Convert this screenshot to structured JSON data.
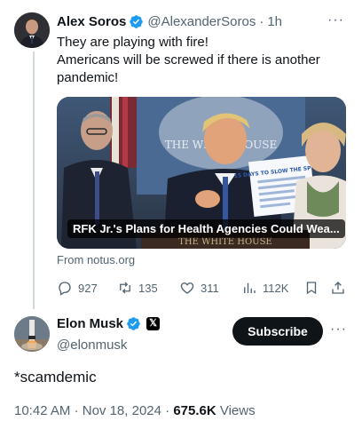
{
  "tweet1": {
    "author_name": "Alex Soros",
    "handle": "@AlexanderSoros",
    "separator": "·",
    "time": "1h",
    "text_lines": [
      "They are playing with fire!",
      "Americans will be screwed if there is another",
      "pandemic!"
    ],
    "card": {
      "caption": "RFK Jr.'s Plans for Health Agencies Could Wea...",
      "source": "From notus.org",
      "sign_text": "THE WHITE HOUSE",
      "sign_text_lower": "THE WHITE HOUSE",
      "paper_text": "15 DAYS TO SLOW THE SPREAD"
    },
    "actions": {
      "replies": "927",
      "reposts": "135",
      "likes": "311",
      "views": "112K"
    }
  },
  "tweet2": {
    "author_name": "Elon Musk",
    "handle": "@elonmusk",
    "affiliate_badge": "𝕏",
    "subscribe_label": "Subscribe",
    "text": "*scamdemic",
    "time": "10:42 AM",
    "separator": "·",
    "date": "Nov 18, 2024",
    "separator2": "·",
    "views_count": "675.6K",
    "views_label": "Views"
  },
  "colors": {
    "verified": "#1d9bf0",
    "secondary_text": "#536471",
    "primary_text": "#0f1419",
    "thread_line": "#cfd9de"
  },
  "icons": [
    "verified-badge-icon",
    "more-icon",
    "reply-icon",
    "repost-icon",
    "like-icon",
    "views-icon",
    "bookmark-icon",
    "share-icon"
  ]
}
